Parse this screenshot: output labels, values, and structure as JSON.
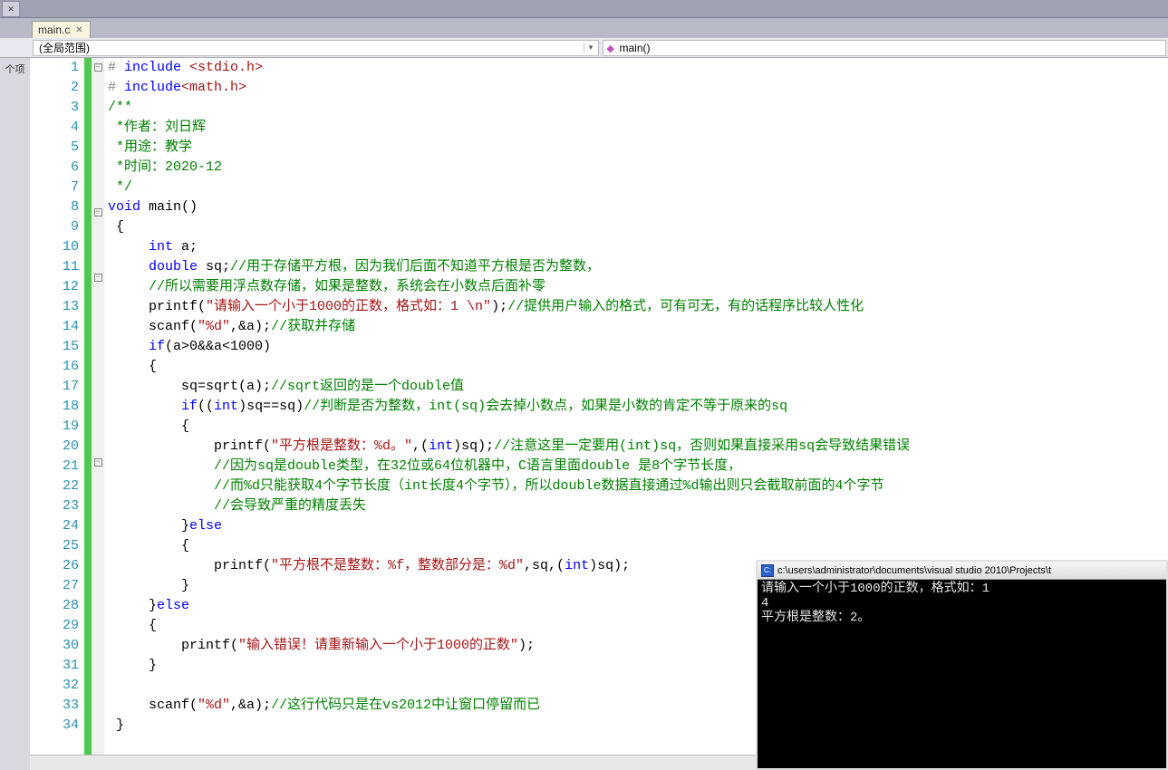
{
  "topbar": {
    "close_left": "✕"
  },
  "tab": {
    "label": "main.c",
    "close": "✕"
  },
  "nav": {
    "scope": "(全局范围)",
    "func": "main()"
  },
  "left_strip_label": "个项",
  "code": {
    "lines": [
      {
        "n": 1,
        "fold": "⊟",
        "segs": [
          {
            "c": "pp",
            "t": "#"
          },
          {
            "c": "kw",
            "t": " include "
          },
          {
            "c": "inc",
            "t": "<stdio.h>"
          }
        ]
      },
      {
        "n": 2,
        "segs": [
          {
            "c": "pp",
            "t": "#"
          },
          {
            "c": "kw",
            "t": " include"
          },
          {
            "c": "inc",
            "t": "<math.h>"
          }
        ]
      },
      {
        "n": 3,
        "segs": [
          {
            "c": "cmt",
            "t": "/**"
          }
        ]
      },
      {
        "n": 4,
        "segs": [
          {
            "c": "cmt",
            "t": " *作者：刘日辉"
          }
        ]
      },
      {
        "n": 5,
        "segs": [
          {
            "c": "cmt",
            "t": " *用途：教学"
          }
        ]
      },
      {
        "n": 6,
        "segs": [
          {
            "c": "cmt",
            "t": " *时间：2020-12"
          }
        ]
      },
      {
        "n": 7,
        "segs": [
          {
            "c": "cmt",
            "t": " */"
          }
        ]
      },
      {
        "n": 8,
        "fold": "⊟",
        "segs": [
          {
            "c": "kw",
            "t": "void"
          },
          {
            "c": "txt",
            "t": " main()"
          }
        ]
      },
      {
        "n": 9,
        "segs": [
          {
            "c": "txt",
            "t": " {"
          }
        ]
      },
      {
        "n": 10,
        "segs": [
          {
            "c": "txt",
            "t": "     "
          },
          {
            "c": "kw",
            "t": "int"
          },
          {
            "c": "txt",
            "t": " a;"
          }
        ]
      },
      {
        "n": 11,
        "fold": "⊟",
        "segs": [
          {
            "c": "txt",
            "t": "     "
          },
          {
            "c": "kw",
            "t": "double"
          },
          {
            "c": "txt",
            "t": " sq;"
          },
          {
            "c": "cmt",
            "t": "//用于存储平方根，因为我们后面不知道平方根是否为整数，"
          }
        ]
      },
      {
        "n": 12,
        "segs": [
          {
            "c": "txt",
            "t": "     "
          },
          {
            "c": "cmt",
            "t": "//所以需要用浮点数存储，如果是整数，系统会在小数点后面补零"
          }
        ]
      },
      {
        "n": 13,
        "segs": [
          {
            "c": "txt",
            "t": "     printf("
          },
          {
            "c": "str",
            "t": "\"请输入一个小于1000的正数，格式如：1 \\n\""
          },
          {
            "c": "txt",
            "t": ");"
          },
          {
            "c": "cmt",
            "t": "//提供用户输入的格式，可有可无，有的话程序比较人性化"
          }
        ]
      },
      {
        "n": 14,
        "segs": [
          {
            "c": "txt",
            "t": "     scanf("
          },
          {
            "c": "str",
            "t": "\"%d\""
          },
          {
            "c": "txt",
            "t": ",&a);"
          },
          {
            "c": "cmt",
            "t": "//获取并存储"
          }
        ]
      },
      {
        "n": 15,
        "segs": [
          {
            "c": "txt",
            "t": "     "
          },
          {
            "c": "kw",
            "t": "if"
          },
          {
            "c": "txt",
            "t": "(a>0&&a<1000)"
          }
        ]
      },
      {
        "n": 16,
        "segs": [
          {
            "c": "txt",
            "t": "     {"
          }
        ]
      },
      {
        "n": 17,
        "segs": [
          {
            "c": "txt",
            "t": "         sq=sqrt(a);"
          },
          {
            "c": "cmt",
            "t": "//sqrt返回的是一个double值"
          }
        ]
      },
      {
        "n": 18,
        "segs": [
          {
            "c": "txt",
            "t": "         "
          },
          {
            "c": "kw",
            "t": "if"
          },
          {
            "c": "txt",
            "t": "(("
          },
          {
            "c": "kw",
            "t": "int"
          },
          {
            "c": "txt",
            "t": ")sq==sq)"
          },
          {
            "c": "cmt",
            "t": "//判断是否为整数，int(sq)会去掉小数点，如果是小数的肯定不等于原来的sq"
          }
        ]
      },
      {
        "n": 19,
        "segs": [
          {
            "c": "txt",
            "t": "         {"
          }
        ]
      },
      {
        "n": 20,
        "fold": "⊟",
        "segs": [
          {
            "c": "txt",
            "t": "             printf("
          },
          {
            "c": "str",
            "t": "\"平方根是整数：%d。\""
          },
          {
            "c": "txt",
            "t": ",("
          },
          {
            "c": "kw",
            "t": "int"
          },
          {
            "c": "txt",
            "t": ")sq);"
          },
          {
            "c": "cmt",
            "t": "//注意这里一定要用(int)sq，否则如果直接采用sq会导致结果错误"
          }
        ]
      },
      {
        "n": 21,
        "segs": [
          {
            "c": "txt",
            "t": "             "
          },
          {
            "c": "cmt",
            "t": "//因为sq是double类型，在32位或64位机器中，C语言里面double 是8个字节长度，"
          }
        ]
      },
      {
        "n": 22,
        "segs": [
          {
            "c": "txt",
            "t": "             "
          },
          {
            "c": "cmt",
            "t": "//而%d只能获取4个字节长度（int长度4个字节），所以double数据直接通过%d输出则只会截取前面的4个字节"
          }
        ]
      },
      {
        "n": 23,
        "segs": [
          {
            "c": "txt",
            "t": "             "
          },
          {
            "c": "cmt",
            "t": "//会导致严重的精度丢失"
          }
        ]
      },
      {
        "n": 24,
        "segs": [
          {
            "c": "txt",
            "t": "         }"
          },
          {
            "c": "kw",
            "t": "else"
          }
        ]
      },
      {
        "n": 25,
        "segs": [
          {
            "c": "txt",
            "t": "         {"
          }
        ]
      },
      {
        "n": 26,
        "segs": [
          {
            "c": "txt",
            "t": "             printf("
          },
          {
            "c": "str",
            "t": "\"平方根不是整数：%f，整数部分是：%d\""
          },
          {
            "c": "txt",
            "t": ",sq,("
          },
          {
            "c": "kw",
            "t": "int"
          },
          {
            "c": "txt",
            "t": ")sq);"
          }
        ]
      },
      {
        "n": 27,
        "segs": [
          {
            "c": "txt",
            "t": "         }"
          }
        ]
      },
      {
        "n": 28,
        "segs": [
          {
            "c": "txt",
            "t": "     }"
          },
          {
            "c": "kw",
            "t": "else"
          }
        ]
      },
      {
        "n": 29,
        "segs": [
          {
            "c": "txt",
            "t": "     {"
          }
        ]
      },
      {
        "n": 30,
        "segs": [
          {
            "c": "txt",
            "t": "         printf("
          },
          {
            "c": "str",
            "t": "\"输入错误！请重新输入一个小于1000的正数\""
          },
          {
            "c": "txt",
            "t": ");"
          }
        ]
      },
      {
        "n": 31,
        "segs": [
          {
            "c": "txt",
            "t": "     }"
          }
        ]
      },
      {
        "n": 32,
        "segs": [
          {
            "c": "txt",
            "t": ""
          }
        ]
      },
      {
        "n": 33,
        "segs": [
          {
            "c": "txt",
            "t": "     scanf("
          },
          {
            "c": "str",
            "t": "\"%d\""
          },
          {
            "c": "txt",
            "t": ",&a);"
          },
          {
            "c": "cmt",
            "t": "//这行代码只是在vs2012中让窗口停留而已"
          }
        ]
      },
      {
        "n": 34,
        "segs": [
          {
            "c": "txt",
            "t": " }"
          }
        ]
      }
    ]
  },
  "console": {
    "title": "c:\\users\\administrator\\documents\\visual studio 2010\\Projects\\t",
    "lines": [
      "请输入一个小于1000的正数，格式如：1",
      "4",
      "平方根是整数：2。"
    ]
  }
}
